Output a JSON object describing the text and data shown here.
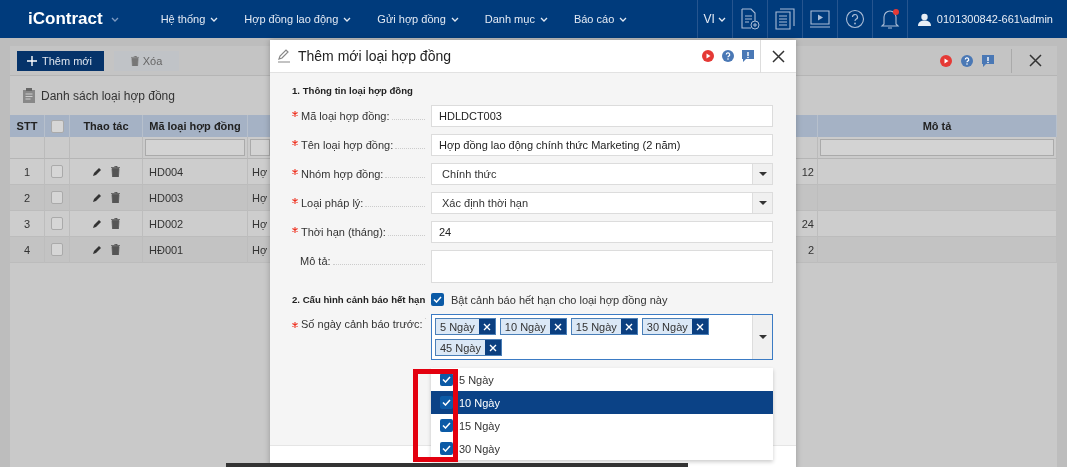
{
  "navbar": {
    "logo": "iContract",
    "menus": [
      {
        "label": "Hệ thống"
      },
      {
        "label": "Hợp đồng lao động"
      },
      {
        "label": "Gửi hợp đồng"
      },
      {
        "label": "Danh mục"
      },
      {
        "label": "Báo cáo"
      }
    ],
    "language": "VI",
    "icons": [
      {
        "kind": "doc-add"
      },
      {
        "kind": "documents"
      },
      {
        "kind": "video"
      },
      {
        "kind": "help"
      },
      {
        "kind": "bell",
        "unread": true
      }
    ],
    "user": "0101300842-661\\admin"
  },
  "page": {
    "toolbar": [
      {
        "label": "Thêm mới",
        "kind": "primary"
      },
      {
        "label": "Xóa",
        "kind": "secondary"
      }
    ],
    "title": "Danh sách loại hợp đồng",
    "table": {
      "columns": [
        {
          "kind": "text",
          "label": "STT",
          "filter": false
        },
        {
          "kind": "checkbox",
          "checked": false,
          "filter": false
        },
        {
          "kind": "text",
          "label": "Thao tác",
          "filter": false
        },
        {
          "kind": "text",
          "label": "Mã loại hợp đồng",
          "filter": true
        },
        {
          "kind": "blank",
          "filter": true
        },
        {
          "kind": "blank",
          "filter": false
        },
        {
          "kind": "text",
          "label": "Mô tả",
          "filter": true
        }
      ],
      "rows": [
        {
          "stt": "1",
          "checked": false,
          "code": "HD004",
          "name": "Hợ",
          "term": "12"
        },
        {
          "stt": "2",
          "checked": false,
          "code": "HD003",
          "name": "Hợ"
        },
        {
          "stt": "3",
          "checked": false,
          "code": "HD002",
          "name": "Hợ",
          "term": "24"
        },
        {
          "stt": "4",
          "checked": false,
          "code": "HĐ001",
          "name": "Hợ",
          "term": "2"
        }
      ]
    }
  },
  "modal": {
    "title": "Thêm mới loại hợp đồng",
    "sections": [
      {
        "heading": "1. Thông tin loại hợp đồng",
        "fields": [
          {
            "kind": "text",
            "required": true,
            "label": "Mã loại hợp đồng:",
            "value": "HDLDCT003"
          },
          {
            "kind": "text",
            "required": true,
            "label": "Tên loại hợp đồng:",
            "value": "Hợp đồng lao động chính thức Marketing (2 năm)"
          },
          {
            "kind": "select",
            "required": true,
            "label": "Nhóm hợp đồng:",
            "value": "Chính thức"
          },
          {
            "kind": "select",
            "required": true,
            "label": "Loại pháp lý:",
            "value": "Xác định thời hạn"
          },
          {
            "kind": "text",
            "required": true,
            "label": "Thời hạn (tháng):",
            "value": "24"
          },
          {
            "kind": "textarea",
            "required": false,
            "label": "Mô tả:"
          }
        ]
      },
      {
        "heading": "2. Cấu hình cảnh báo hết hạn",
        "toggle": {
          "label": "Bật cảnh báo hết hạn cho loại hợp đồng này",
          "checked": true
        },
        "fields": [
          {
            "kind": "multiselect",
            "required": true,
            "label": "Số ngày cảnh báo trước:",
            "tags": [
              "5 Ngày",
              "10 Ngày",
              "15 Ngày",
              "30 Ngày",
              "45 Ngày"
            ],
            "open": true,
            "options": [
              {
                "label": "5 Ngày",
                "checked": true,
                "selected": false
              },
              {
                "label": "10 Ngày",
                "checked": true,
                "selected": true
              },
              {
                "label": "15 Ngày",
                "checked": true,
                "selected": false
              },
              {
                "label": "30 Ngày",
                "checked": true,
                "selected": false
              }
            ]
          }
        ]
      }
    ]
  }
}
